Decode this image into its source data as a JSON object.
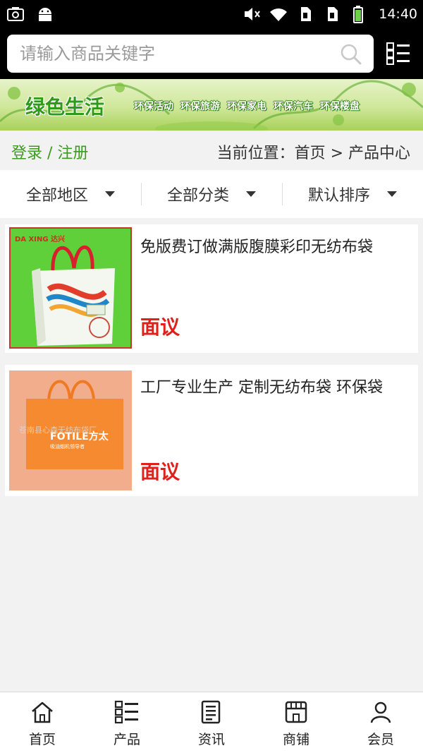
{
  "status_bar": {
    "time": "14:40",
    "left_icons": [
      "screenshot-icon",
      "android-icon"
    ],
    "right_icons": [
      "mute-icon",
      "wifi-icon",
      "sim1-icon",
      "sim2-icon",
      "battery-icon"
    ]
  },
  "search": {
    "placeholder": "请输入商品关键字",
    "value": ""
  },
  "banner": {
    "title": "绿色生活",
    "tags": [
      "环保活动",
      "环保旅游",
      "环保家电",
      "环保汽车",
      "环保楼盘"
    ]
  },
  "crumbbar": {
    "login_label": "登录 / 注册",
    "location": "当前位置：首页 > 产品中心"
  },
  "filters": [
    {
      "label": "全部地区"
    },
    {
      "label": "全部分类"
    },
    {
      "label": "默认排序"
    }
  ],
  "products": [
    {
      "title": "免版费订做满版腹膜彩印无纺布袋",
      "price": "面议",
      "image_brand": "DA XING 达兴"
    },
    {
      "title": "工厂专业生产 定制无纺布袋 环保袋",
      "price": "面议",
      "image_brand": "FOTILE方太",
      "image_brand_sub": "吸油烟机领导者",
      "image_watermark": "苍南县心森无纺布袋厂"
    }
  ],
  "tabs": [
    {
      "label": "首页",
      "icon": "home-icon"
    },
    {
      "label": "产品",
      "icon": "product-list-icon"
    },
    {
      "label": "资讯",
      "icon": "news-icon"
    },
    {
      "label": "商铺",
      "icon": "store-icon"
    },
    {
      "label": "会员",
      "icon": "member-icon"
    }
  ],
  "colors": {
    "accent_green": "#3e9a1f",
    "price_red": "#e0201a",
    "header_black": "#000000"
  }
}
